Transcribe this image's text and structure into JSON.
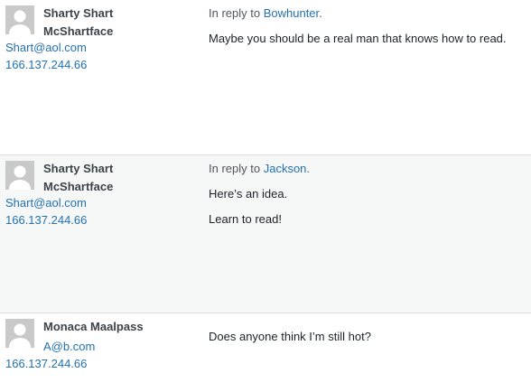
{
  "comments": [
    {
      "author_name": "Sharty Shart McShartface",
      "email": "Shart@aol.com",
      "ip": "166.137.244.66",
      "reply_prefix": "In reply to",
      "reply_target": "Bowhunter",
      "reply_suffix": ".",
      "paragraphs": [
        "Maybe you should be a real man that knows how to read."
      ]
    },
    {
      "author_name": "Sharty Shart McShartface",
      "email": "Shart@aol.com",
      "ip": "166.137.244.66",
      "reply_prefix": "In reply to",
      "reply_target": "Jackson",
      "reply_suffix": ".",
      "paragraphs": [
        "Here’s an idea.",
        "Learn to read!"
      ]
    },
    {
      "author_name": "Monaca Maalpass",
      "email": "A@b.com",
      "ip": "166.137.244.66",
      "paragraphs": [
        "Does anyone think I’m still hot?"
      ]
    }
  ]
}
